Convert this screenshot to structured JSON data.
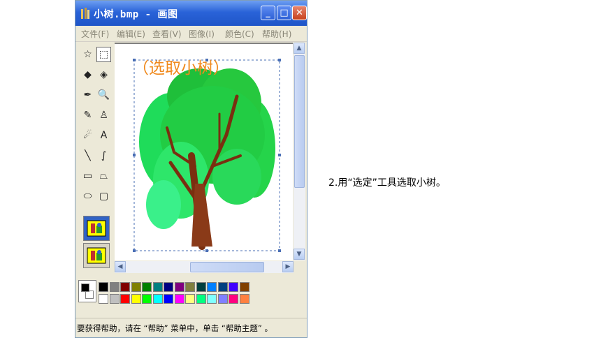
{
  "window": {
    "title": "小树.bmp - 画图",
    "minimize_glyph": "_",
    "maximize_glyph": "□",
    "close_glyph": "✕"
  },
  "menu": [
    "文件(F)",
    "编辑(E)",
    "查看(V)",
    "图像(I)",
    "颜色(C)",
    "帮助(H)"
  ],
  "tools": [
    {
      "name": "free-select-tool-icon",
      "glyph": "☆"
    },
    {
      "name": "rect-select-tool-icon",
      "glyph": "⬚"
    },
    {
      "name": "eraser-tool-icon",
      "glyph": "◆"
    },
    {
      "name": "fill-tool-icon",
      "glyph": "◈"
    },
    {
      "name": "color-picker-tool-icon",
      "glyph": "✒"
    },
    {
      "name": "magnifier-tool-icon",
      "glyph": "🔍"
    },
    {
      "name": "pencil-tool-icon",
      "glyph": "✎"
    },
    {
      "name": "brush-tool-icon",
      "glyph": "♙"
    },
    {
      "name": "airbrush-tool-icon",
      "glyph": "☄"
    },
    {
      "name": "text-tool-icon",
      "glyph": "A"
    },
    {
      "name": "line-tool-icon",
      "glyph": "╲"
    },
    {
      "name": "curve-tool-icon",
      "glyph": "∫"
    },
    {
      "name": "rectangle-tool-icon",
      "glyph": "▭"
    },
    {
      "name": "polygon-tool-icon",
      "glyph": "⏢"
    },
    {
      "name": "ellipse-tool-icon",
      "glyph": "⬭"
    },
    {
      "name": "rounded-rect-tool-icon",
      "glyph": "▢"
    }
  ],
  "palette": {
    "foreground": "#000000",
    "background": "#ffffff",
    "row1": [
      "#000000",
      "#808080",
      "#800000",
      "#808000",
      "#008000",
      "#008080",
      "#000080",
      "#800080",
      "#808040",
      "#004040",
      "#0080ff",
      "#004080",
      "#4000ff",
      "#804000"
    ],
    "row2": [
      "#ffffff",
      "#c0c0c0",
      "#ff0000",
      "#ffff00",
      "#00ff00",
      "#00ffff",
      "#0000ff",
      "#ff00ff",
      "#ffff80",
      "#00ff80",
      "#80ffff",
      "#8080ff",
      "#ff0080",
      "#ff8040"
    ]
  },
  "status_text": "要获得帮助，请在 “帮助” 菜单中，单击 “帮助主题” 。",
  "overlay_label": "（选取小树）",
  "caption": "2.用“选定”工具选取小树。"
}
